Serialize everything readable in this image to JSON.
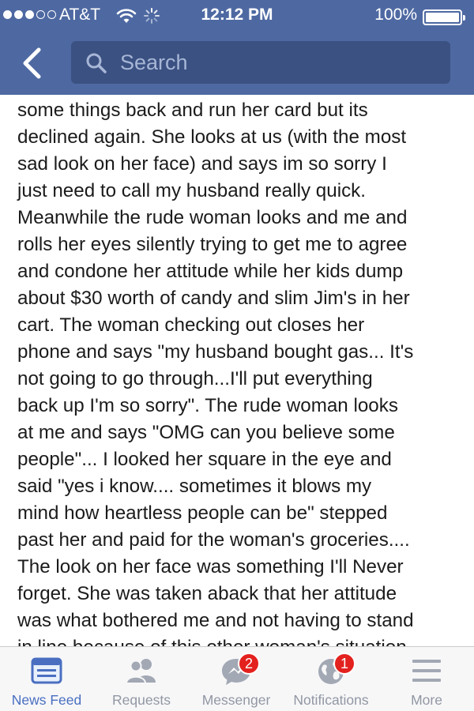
{
  "status_bar": {
    "carrier": "AT&T",
    "time": "12:12 PM",
    "battery": "100%",
    "battery_level": 1.0
  },
  "nav": {
    "search_placeholder": "Search"
  },
  "post": {
    "lines": [
      "some things back and run her card but its",
      "declined again. She looks at us (with the most",
      "sad look on her face) and says im so sorry I",
      "just need to call my husband really quick.",
      "Meanwhile the rude woman looks and me and",
      "rolls her eyes silently trying to get me to agree",
      "and condone her attitude while her kids dump",
      "about $30 worth of candy and slim Jim's in her",
      "cart. The woman checking out closes her",
      "phone and says \"my husband bought gas... It's",
      "not going to go through...I'll put everything",
      "back up I'm so sorry\". The rude woman looks",
      "at me and says \"OMG can you believe some",
      "people\"... I looked her square in the eye and",
      "said \"yes i know.... sometimes it blows my",
      "mind how heartless people can be\" stepped",
      "past her and paid for the woman's groceries....",
      "The look on her face was something I'll Never",
      "forget. She was taken aback that her attitude",
      "was what bothered me and not having to stand",
      "in line because of this other woman's situation."
    ]
  },
  "tabbar": {
    "news_feed": "News Feed",
    "requests": "Requests",
    "messenger": "Messenger",
    "messenger_badge": "2",
    "notifications": "Notifications",
    "notifications_badge": "1",
    "more": "More"
  },
  "colors": {
    "header_bg": "#4e69a2",
    "search_bg": "#3b5182",
    "active_tab": "#4a6fc1",
    "inactive_tab": "#9197a3",
    "badge": "#e3211e"
  }
}
